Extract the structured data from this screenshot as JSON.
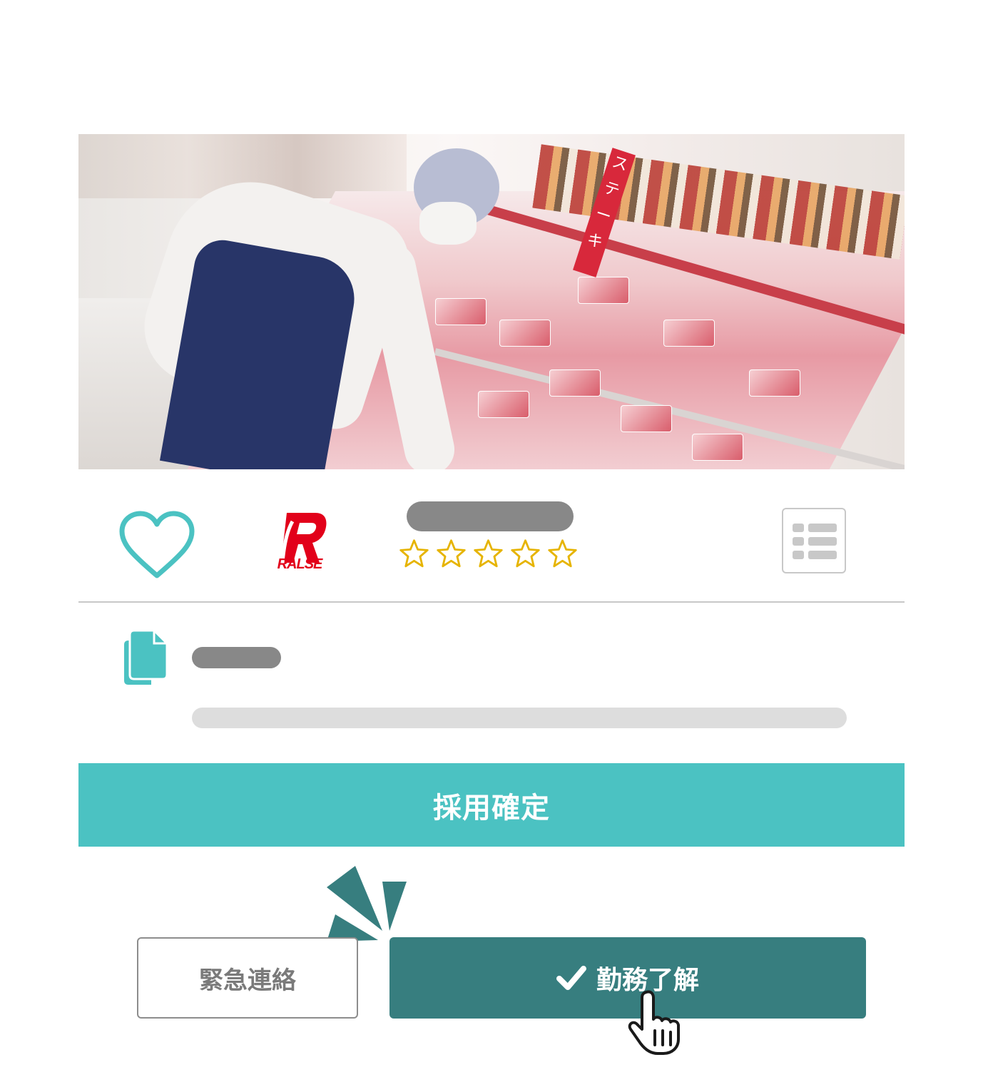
{
  "hero": {
    "sign_text": "ステーキ"
  },
  "card": {
    "favorite_icon": "heart-icon",
    "company_logo_text": "RALSE",
    "rating_stars": 0,
    "rating_max": 5,
    "list_icon": "list-icon",
    "document_icon": "document-icon"
  },
  "actions": {
    "confirm_label": "採用確定",
    "emergency_label": "緊急連絡",
    "acknowledge_label": "勤務了解",
    "acknowledge_icon": "check-icon"
  },
  "colors": {
    "accent": "#4bc2c2",
    "dark_accent": "#377e7f",
    "brand_red": "#e2001a",
    "star": "#e6b400"
  }
}
